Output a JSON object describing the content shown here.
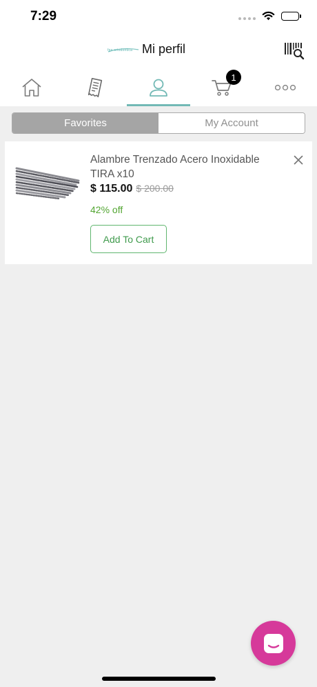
{
  "status_bar": {
    "time": "7:29"
  },
  "header": {
    "logo_text": "fga ortodontica",
    "title": "Mi perfil"
  },
  "tabs": [
    {
      "name": "home",
      "icon": "home-icon"
    },
    {
      "name": "orders",
      "icon": "receipt-icon"
    },
    {
      "name": "profile",
      "icon": "user-icon",
      "active": true
    },
    {
      "name": "cart",
      "icon": "cart-icon",
      "badge": "1"
    },
    {
      "name": "more",
      "icon": "more-icon"
    }
  ],
  "segments": {
    "favorites": "Favorites",
    "account": "My Account"
  },
  "favorites": [
    {
      "name": "Alambre Trenzado Acero Inoxidable TIRA x10",
      "price": "$ 115.00",
      "old_price": "$ 200.00",
      "discount": "42% off",
      "add_to_cart": "Add To Cart"
    }
  ],
  "colors": {
    "accent": "#72b9b5",
    "discount": "#52a531",
    "add_to_cart_border": "#5fb56e",
    "fab": "#d6399a",
    "badge": "#000000",
    "segment_active": "#a5a5a5"
  }
}
